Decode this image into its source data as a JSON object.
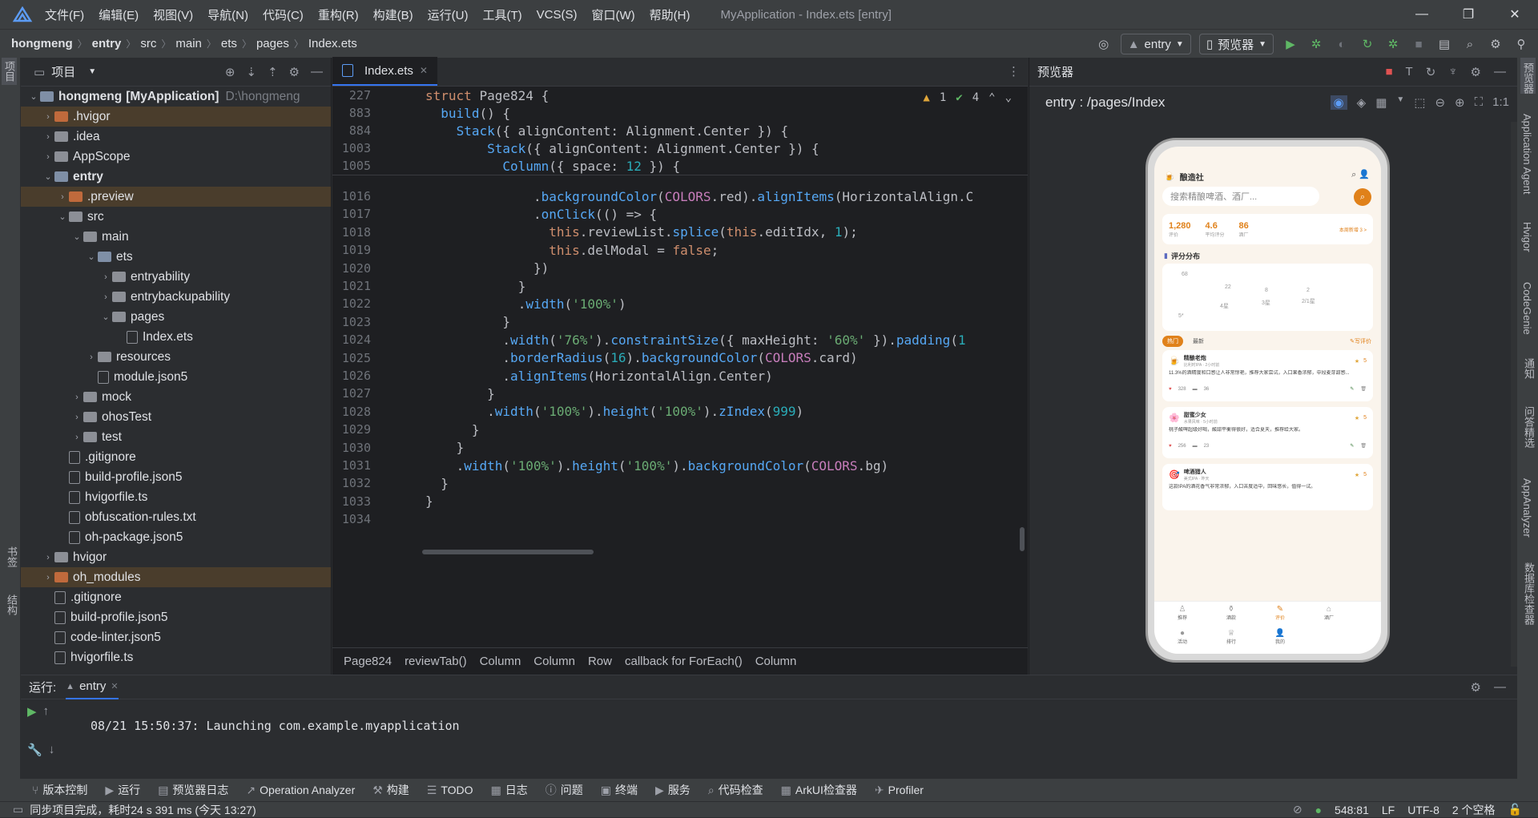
{
  "titlebar": {
    "menu": [
      "文件(F)",
      "编辑(E)",
      "视图(V)",
      "导航(N)",
      "代码(C)",
      "重构(R)",
      "构建(B)",
      "运行(U)",
      "工具(T)",
      "VCS(S)",
      "窗口(W)",
      "帮助(H)"
    ],
    "window_title": "MyApplication - Index.ets [entry]"
  },
  "navbar": {
    "breadcrumb": [
      "hongmeng",
      "entry",
      "src",
      "main",
      "ets",
      "pages",
      "Index.ets"
    ],
    "run_config": "entry",
    "device": "预览器"
  },
  "project": {
    "title": "项目",
    "tree": [
      {
        "label": "hongmeng",
        "suffix": "[MyApplication]",
        "path": "D:\\hongmeng",
        "depth": 0,
        "type": "module",
        "open": true
      },
      {
        "label": ".hvigor",
        "depth": 1,
        "type": "orange",
        "open": false,
        "hl": true
      },
      {
        "label": ".idea",
        "depth": 1,
        "type": "gray",
        "open": false
      },
      {
        "label": "AppScope",
        "depth": 1,
        "type": "gray",
        "open": false
      },
      {
        "label": "entry",
        "depth": 1,
        "type": "module",
        "open": true,
        "bold": true
      },
      {
        "label": ".preview",
        "depth": 2,
        "type": "orange",
        "open": false,
        "hl": true
      },
      {
        "label": "src",
        "depth": 2,
        "type": "gray",
        "open": true
      },
      {
        "label": "main",
        "depth": 3,
        "type": "gray",
        "open": true
      },
      {
        "label": "ets",
        "depth": 4,
        "type": "blue",
        "open": true
      },
      {
        "label": "entryability",
        "depth": 5,
        "type": "gray",
        "open": false
      },
      {
        "label": "entrybackupability",
        "depth": 5,
        "type": "gray",
        "open": false
      },
      {
        "label": "pages",
        "depth": 5,
        "type": "gray",
        "open": true
      },
      {
        "label": "Index.ets",
        "depth": 6,
        "type": "file"
      },
      {
        "label": "resources",
        "depth": 4,
        "type": "gray",
        "open": false
      },
      {
        "label": "module.json5",
        "depth": 4,
        "type": "file"
      },
      {
        "label": "mock",
        "depth": 3,
        "type": "gray",
        "open": false
      },
      {
        "label": "ohosTest",
        "depth": 3,
        "type": "gray",
        "open": false
      },
      {
        "label": "test",
        "depth": 3,
        "type": "gray",
        "open": false
      },
      {
        "label": ".gitignore",
        "depth": 2,
        "type": "file"
      },
      {
        "label": "build-profile.json5",
        "depth": 2,
        "type": "file"
      },
      {
        "label": "hvigorfile.ts",
        "depth": 2,
        "type": "file"
      },
      {
        "label": "obfuscation-rules.txt",
        "depth": 2,
        "type": "file"
      },
      {
        "label": "oh-package.json5",
        "depth": 2,
        "type": "file"
      },
      {
        "label": "hvigor",
        "depth": 1,
        "type": "gray",
        "open": false
      },
      {
        "label": "oh_modules",
        "depth": 1,
        "type": "orange",
        "open": false,
        "hl": true
      },
      {
        "label": ".gitignore",
        "depth": 1,
        "type": "file"
      },
      {
        "label": "build-profile.json5",
        "depth": 1,
        "type": "file"
      },
      {
        "label": "code-linter.json5",
        "depth": 1,
        "type": "file"
      },
      {
        "label": "hvigorfile.ts",
        "depth": 1,
        "type": "file"
      }
    ]
  },
  "editor": {
    "tab": "Index.ets",
    "warnings": "1",
    "ok": "4",
    "sticky": [
      {
        "ln": "227",
        "code": "struct Page824 {"
      },
      {
        "ln": "883",
        "code": "  build() {"
      },
      {
        "ln": "884",
        "code": "    Stack({ alignContent: Alignment.Center }) {"
      },
      {
        "ln": "1003",
        "code": "        Stack({ alignContent: Alignment.Center }) {"
      },
      {
        "ln": "1005",
        "code": "          Column({ space: 12 }) {"
      }
    ],
    "lines": [
      {
        "ln": "1016",
        "code": "              .backgroundColor(COLORS.red).alignItems(HorizontalAlign.C"
      },
      {
        "ln": "1017",
        "code": "              .onClick(() => {"
      },
      {
        "ln": "1018",
        "code": "                this.reviewList.splice(this.editIdx, 1);"
      },
      {
        "ln": "1019",
        "code": "                this.delModal = false;"
      },
      {
        "ln": "1020",
        "code": "              })"
      },
      {
        "ln": "1021",
        "code": "            }"
      },
      {
        "ln": "1022",
        "code": "            .width('100%')"
      },
      {
        "ln": "1023",
        "code": "          }"
      },
      {
        "ln": "1024",
        "code": "          .width('76%').constraintSize({ maxHeight: '60%' }).padding(1"
      },
      {
        "ln": "1025",
        "code": "          .borderRadius(16).backgroundColor(COLORS.card)"
      },
      {
        "ln": "1026",
        "code": "          .alignItems(HorizontalAlign.Center)"
      },
      {
        "ln": "1027",
        "code": "        }"
      },
      {
        "ln": "1028",
        "code": "        .width('100%').height('100%').zIndex(999)"
      },
      {
        "ln": "1029",
        "code": "      }"
      },
      {
        "ln": "1030",
        "code": "    }"
      },
      {
        "ln": "1031",
        "code": "    .width('100%').height('100%').backgroundColor(COLORS.bg)"
      },
      {
        "ln": "1032",
        "code": "  }"
      },
      {
        "ln": "1033",
        "code": "}"
      },
      {
        "ln": "1034",
        "code": ""
      }
    ],
    "breadcrumbs": [
      "Page824",
      "reviewTab()",
      "Column",
      "Column",
      "Row",
      "callback for ForEach()",
      "Column"
    ]
  },
  "preview": {
    "title": "预览器",
    "path": "entry : /pages/Index",
    "app": {
      "name": "酿造社",
      "search_placeholder": "搜索精酿啤酒、酒厂...",
      "stats": [
        {
          "v": "1,280",
          "l": "评价"
        },
        {
          "v": "4.6",
          "l": "平均评分"
        },
        {
          "v": "86",
          "l": "酒厂"
        }
      ],
      "stats_link": "本周新增 3 >",
      "dist_title": "评分分布",
      "dist_values": [
        "68",
        "22",
        "8",
        "2",
        "5*",
        "4星",
        "3星",
        "2/1星"
      ],
      "tabs": [
        "热门",
        "最新"
      ],
      "write": "写评价",
      "reviews": [
        {
          "user": "精酿老炮",
          "meta": "比利时IPA · 2小时前",
          "stars": "5",
          "text": "11.3%的酒精度和口感让人非常惊艳，推荐大家尝试，入口果香浓郁，中段麦芽甜感...",
          "likes": "328",
          "comments": "36"
        },
        {
          "user": "甜蜜少女",
          "meta": "水果风味 · 5小时前",
          "text": "桃子酸啤超级好喝，酸甜平衡得很好，适合夏天，推荐给大家。",
          "stars": "5",
          "likes": "256",
          "comments": "23"
        },
        {
          "user": "啤酒猎人",
          "meta": "美式IPA · 昨天",
          "text": "这款IPA的酒花香气非常浓郁，入口苦度适中，回味悠长，值得一试。",
          "stars": "5",
          "likes": "",
          "comments": ""
        }
      ],
      "bottom_nav": [
        "推荐",
        "酒款",
        "评价",
        "酒厂",
        "活动",
        "排行",
        "我的"
      ]
    }
  },
  "run": {
    "label": "运行:",
    "tab": "entry",
    "log": "08/21 15:50:37: Launching com.example.myapplication"
  },
  "toolwindows": [
    "版本控制",
    "运行",
    "预览器日志",
    "Operation Analyzer",
    "构建",
    "TODO",
    "日志",
    "问题",
    "终端",
    "服务",
    "代码检查",
    "ArkUI检查器",
    "Profiler"
  ],
  "status": {
    "message": "同步项目完成，耗时24 s 391 ms (今天 13:27)",
    "position": "548:81",
    "le": "LF",
    "encoding": "UTF-8",
    "indent": "2 个空格"
  },
  "right_stripe": [
    "预览器",
    "Application Agent",
    "Hvigor",
    "CodeGenie",
    "通知",
    "问答精选",
    "AppAnalyzer",
    "数据库检查器"
  ],
  "left_stripe": [
    "项目",
    "书签",
    "结构"
  ],
  "colors": {
    "accent": "#3574f0",
    "app_orange": "#e0811a",
    "app_bg": "#faf4ec"
  }
}
